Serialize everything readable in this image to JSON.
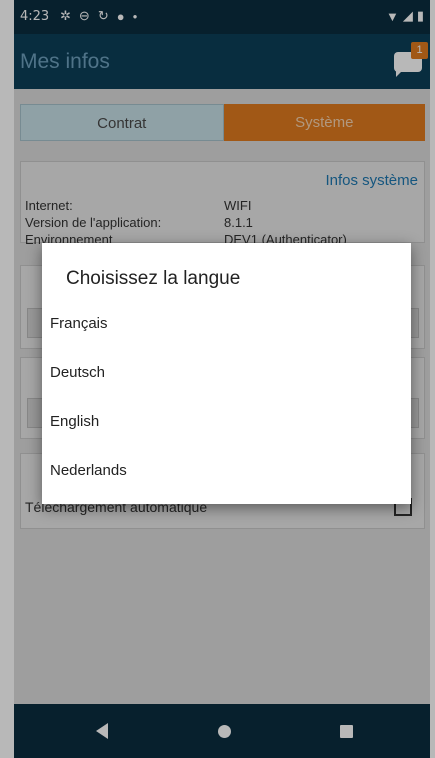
{
  "status_bar": {
    "time": "4:23",
    "left_icons": [
      "settings-icon",
      "cast-icon",
      "sync-icon",
      "message-icon",
      "dot-icon"
    ],
    "right_icons": [
      "wifi-icon",
      "signal-icon",
      "battery-icon"
    ]
  },
  "app_bar": {
    "title": "Mes infos",
    "notification_count": "1"
  },
  "tabs": [
    {
      "label": "Contrat",
      "active": false
    },
    {
      "label": "Système",
      "active": true
    }
  ],
  "system_info": {
    "title": "Infos système",
    "rows": [
      {
        "key": "Internet:",
        "value": "WIFI"
      },
      {
        "key": "Version de l'application:",
        "value": "8.1.1"
      },
      {
        "key": "Environnement",
        "value": "DEV1 (Authenticator)"
      }
    ]
  },
  "settings": {
    "auto_download_label": "Téléchargement automatique"
  },
  "dialog": {
    "title": "Choisissez la langue",
    "options": [
      "Français",
      "Deutsch",
      "English",
      "Nederlands"
    ]
  },
  "colors": {
    "status_bar": "#0a2d3f",
    "app_bar": "#0c3f58",
    "accent_orange": "#e07a1f",
    "link_blue": "#1e78b0"
  }
}
